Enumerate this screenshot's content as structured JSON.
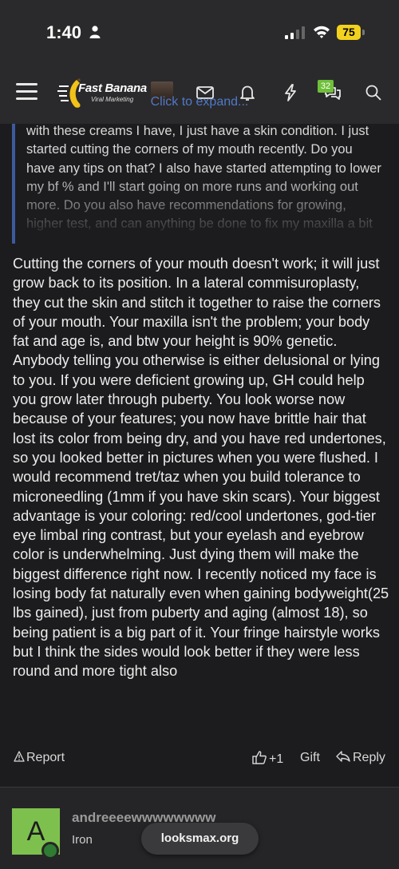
{
  "status_bar": {
    "time": "1:40",
    "battery": "75"
  },
  "nav": {
    "logo_title": "Fast Banana",
    "logo_subtitle": "Viral Marketing",
    "chat_badge": "32"
  },
  "quote": {
    "text": "with these creams I have, I just have a skin condition. I just started cutting the corners of my mouth recently. Do you have any tips on that? I also have started attempting to lower my bf % and I'll start going on more runs and working out more. Do you also have recommendations for growing, higher test, and can anything be done to fix my maxilla a bit",
    "expand_label": "Click to expand..."
  },
  "post": {
    "body": "Cutting the corners of your mouth doesn't work; it will just grow back to its position. In a lateral commisuroplasty, they cut the skin and stitch it together to raise the corners of your mouth. Your maxilla isn't the problem; your body fat and age is, and btw your height is 90% genetic. Anybody telling you otherwise is either delusional or lying to you. If you were deficient growing up, GH could help you grow later through puberty. You look worse now because of your features; you now have brittle hair that lost its color from being dry, and you have red undertones, so you looked better in pictures when you were flushed. I would recommend tret/taz when you build tolerance to microneedling (1mm if you have skin scars). Your biggest advantage is your coloring: red/cool undertones, god-tier eye limbal ring contrast, but your eyelash and eyebrow color is underwhelming. Just dying them will make the biggest difference right now. I recently noticed my face is losing body fat naturally even when gaining bodyweight(25 lbs gained), just from puberty and aging (almost 18), so being patient is a big part of it. Your fringe hairstyle works but I think the sides would look better if they were less round and more tight also"
  },
  "actions": {
    "report": "Report",
    "like_count": "+1",
    "gift": "Gift",
    "reply": "Reply"
  },
  "next_post": {
    "avatar_letter": "A",
    "username": "andreeeewwwwwwww",
    "rank": "Iron"
  },
  "site_pill": "looksmax.org",
  "colors": {
    "background": "#1c1c1e",
    "header": "#2a2a2c",
    "accent_link": "#4f79c8",
    "quote_border": "#3c5a9e",
    "badge_green": "#6fbf3a",
    "avatar_green": "#7ec04e"
  }
}
